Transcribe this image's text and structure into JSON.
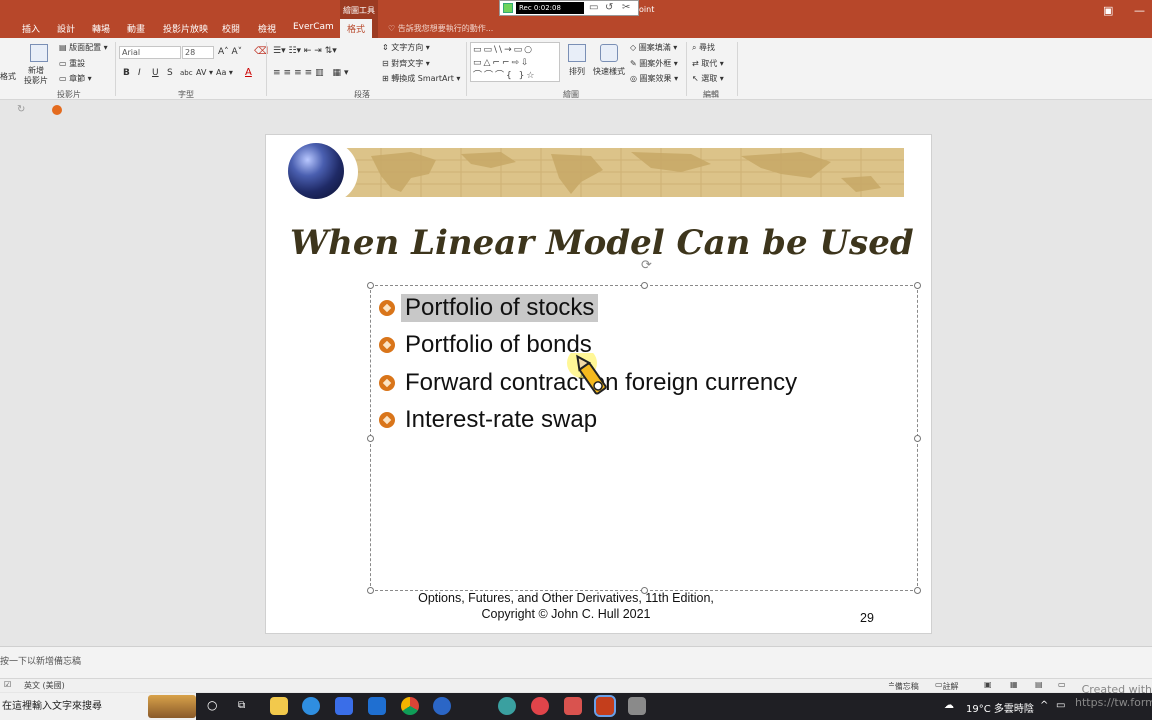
{
  "tabs": [
    {
      "label": "插入"
    },
    {
      "label": "設計"
    },
    {
      "label": "轉場"
    },
    {
      "label": "動畫"
    },
    {
      "label": "投影片放映"
    },
    {
      "label": "校閱"
    },
    {
      "label": "檢視"
    },
    {
      "label": "EverCam"
    },
    {
      "label": "格式"
    }
  ],
  "context_header": "繪圖工具",
  "tell_me": "告訴我您想要執行的動作...",
  "recorder": {
    "timer": "Rec 0:02:08",
    "title_tail": "oint"
  },
  "ribbon": {
    "new_slide": "新增\n投影片",
    "layout": "版面配置",
    "reset": "重設",
    "section": "章節",
    "font_name": "Arial",
    "font_size": "28",
    "text_direction": "文字方向",
    "align_text": "對齊文字",
    "convert_smartart": "轉換成 SmartArt",
    "arrange": "排列",
    "quick_styles": "快速樣式",
    "shape_fill": "圖案填滿",
    "shape_outline": "圖案外框",
    "shape_effects": "圖案效果",
    "find": "尋找",
    "replace": "取代",
    "select": "選取",
    "groups": {
      "slides": "投影片",
      "font": "字型",
      "paragraph": "段落",
      "drawing": "繪圖",
      "editing": "編輯"
    },
    "left_partial": "格式"
  },
  "slide": {
    "title": "When Linear Model Can be Used",
    "bullets": [
      {
        "text": "Portfolio of stocks",
        "selected": true
      },
      {
        "text": "Portfolio of bonds",
        "selected": false
      },
      {
        "text": "Forward contract on foreign currency",
        "selected": false
      },
      {
        "text": "Interest-rate swap",
        "selected": false
      }
    ],
    "footer_line1": "Options, Futures, and Other Derivatives,  11th Edition,",
    "footer_line2": "Copyright © John  C. Hull 2021",
    "page_number": "29"
  },
  "notes_placeholder": "按一下以新增備忘稿",
  "status": {
    "language": "英文 (美國)",
    "notes": "備忘稿",
    "comments": "註解"
  },
  "taskbar": {
    "search": "在這裡輸入文字來搜尋",
    "weather": "19°C  多雲時陰"
  },
  "watermark": {
    "line1": "Created with",
    "line2": "https://tw.formi"
  },
  "colors": {
    "accent": "#b7472a",
    "title_text": "#3d351c",
    "bullet": "#d9751a",
    "banner": "#dcc389"
  }
}
